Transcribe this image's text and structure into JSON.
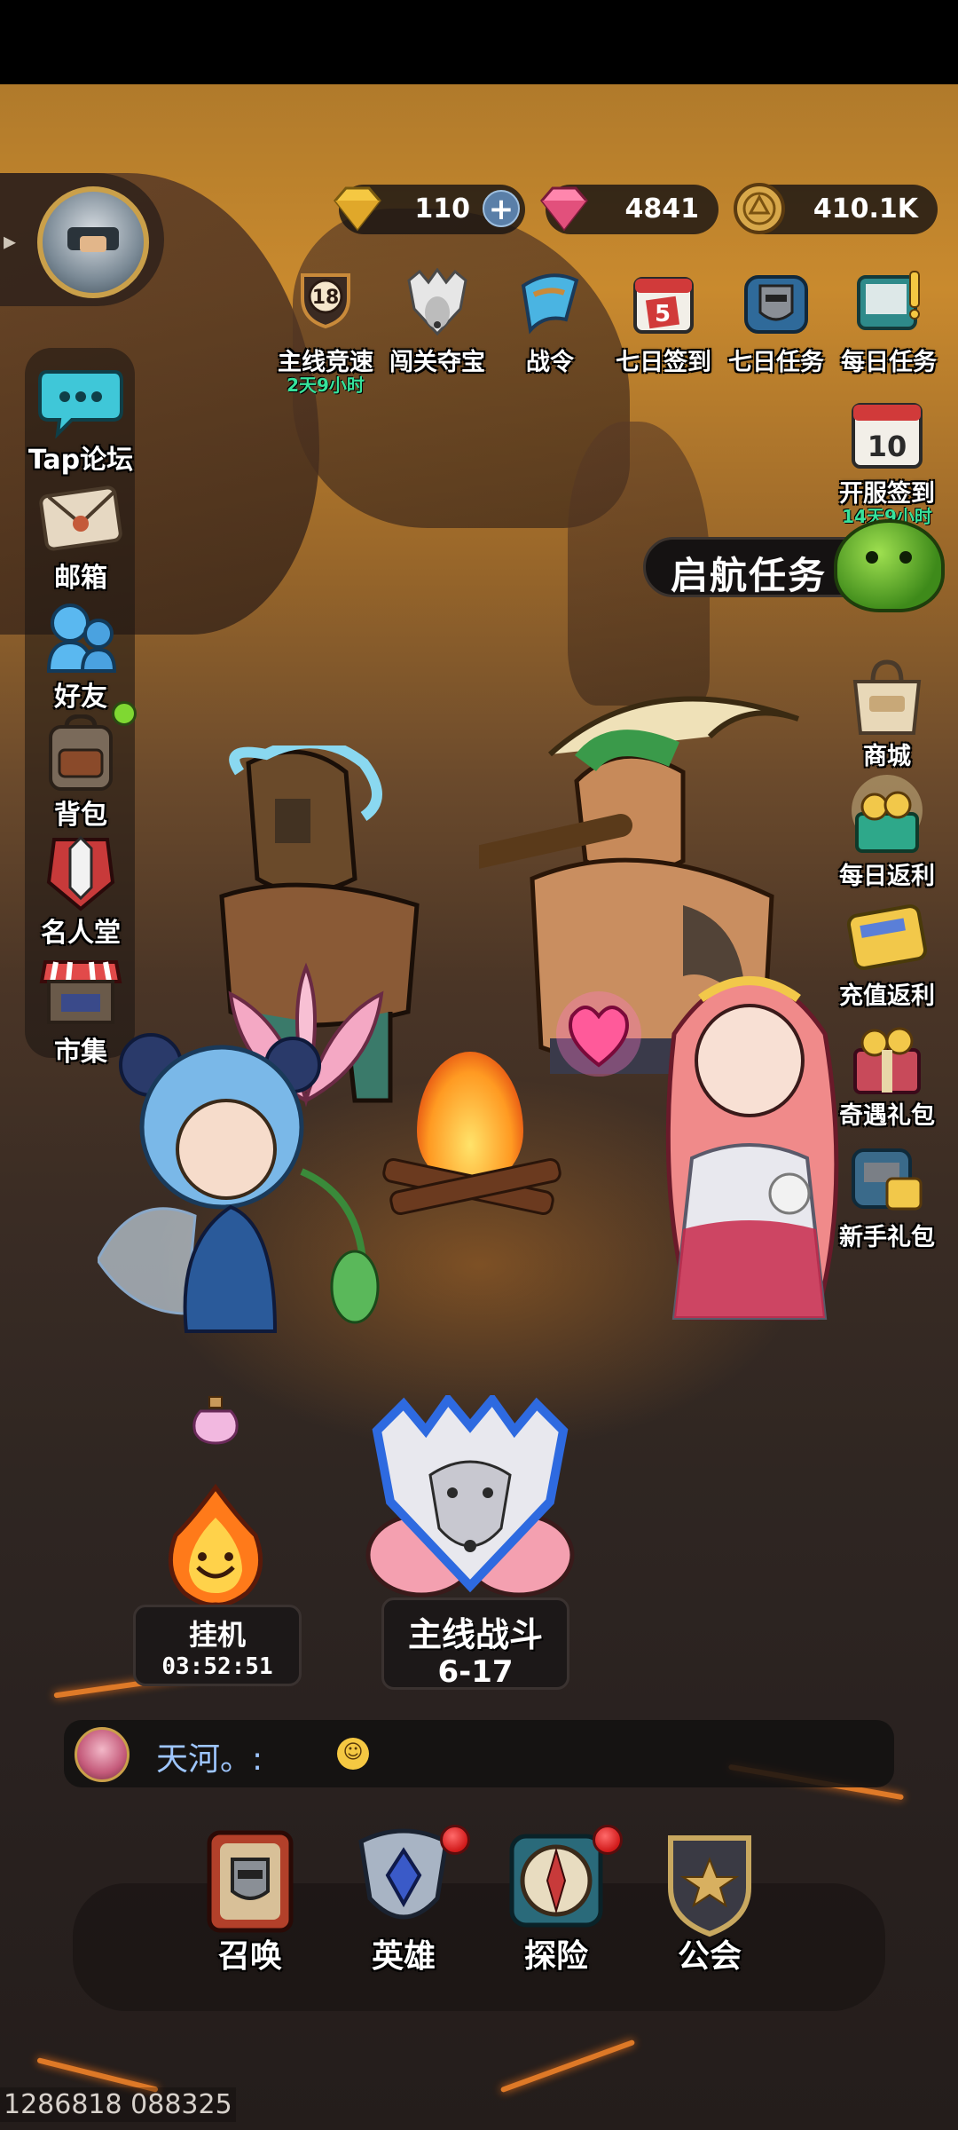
{
  "currencies": [
    {
      "name": "gold-gem",
      "value": "110",
      "color": "#f5c842"
    },
    {
      "name": "pink-gem",
      "value": "4841",
      "color": "#ff6f9c"
    },
    {
      "name": "coin",
      "value": "410.1K",
      "color": "#d8a84a"
    }
  ],
  "top_icons": [
    {
      "label": "主线竞速",
      "sub": "2天9小时",
      "badge": "18",
      "icon": "trophy-icon"
    },
    {
      "label": "闯关夺宝",
      "icon": "wolf-crest-icon"
    },
    {
      "label": "战令",
      "icon": "banner-flag-icon"
    },
    {
      "label": "七日签到",
      "badge": "5",
      "icon": "calendar-icon"
    },
    {
      "label": "七日任务",
      "icon": "helmet-shield-icon"
    },
    {
      "label": "每日任务",
      "icon": "notebook-icon"
    }
  ],
  "left_menu": [
    {
      "label": "Tap论坛",
      "icon": "chat-bubble-icon"
    },
    {
      "label": "邮箱",
      "icon": "envelope-icon"
    },
    {
      "label": "好友",
      "icon": "friends-icon"
    },
    {
      "label": "背包",
      "icon": "backpack-icon"
    },
    {
      "label": "名人堂",
      "icon": "hall-of-fame-icon"
    },
    {
      "label": "市集",
      "icon": "market-stall-icon"
    }
  ],
  "right_menu": [
    {
      "label": "开服签到",
      "sub": "14天9小时",
      "badge": "10",
      "icon": "calendar-icon"
    },
    {
      "label": "商城",
      "icon": "shop-bag-icon"
    },
    {
      "label": "每日返利",
      "icon": "gift-basket-icon"
    },
    {
      "label": "充值返利",
      "icon": "match-card-icon"
    },
    {
      "label": "奇遇礼包",
      "icon": "gift-box-icon"
    },
    {
      "label": "新手礼包",
      "icon": "starter-chest-icon"
    }
  ],
  "quest_banner": {
    "label": "启航任务"
  },
  "idle": {
    "label": "挂机",
    "timer": "03:52:51"
  },
  "main_battle": {
    "label": "主线战斗",
    "stage": "6-17"
  },
  "chat": {
    "message": "天河。:",
    "emoji": "grinning-emoji"
  },
  "bottom_nav": [
    {
      "label": "召唤",
      "icon": "summon-book-icon",
      "dot": false
    },
    {
      "label": "英雄",
      "icon": "hero-crest-icon",
      "dot": true
    },
    {
      "label": "探险",
      "icon": "compass-icon",
      "dot": true
    },
    {
      "label": "公会",
      "icon": "guild-shield-icon",
      "dot": false
    }
  ],
  "uid": "1286818 088325",
  "colors": {
    "accent_green": "#37e29b",
    "badge_red": "#d11a1a",
    "chat_name": "#9ec6ff"
  }
}
